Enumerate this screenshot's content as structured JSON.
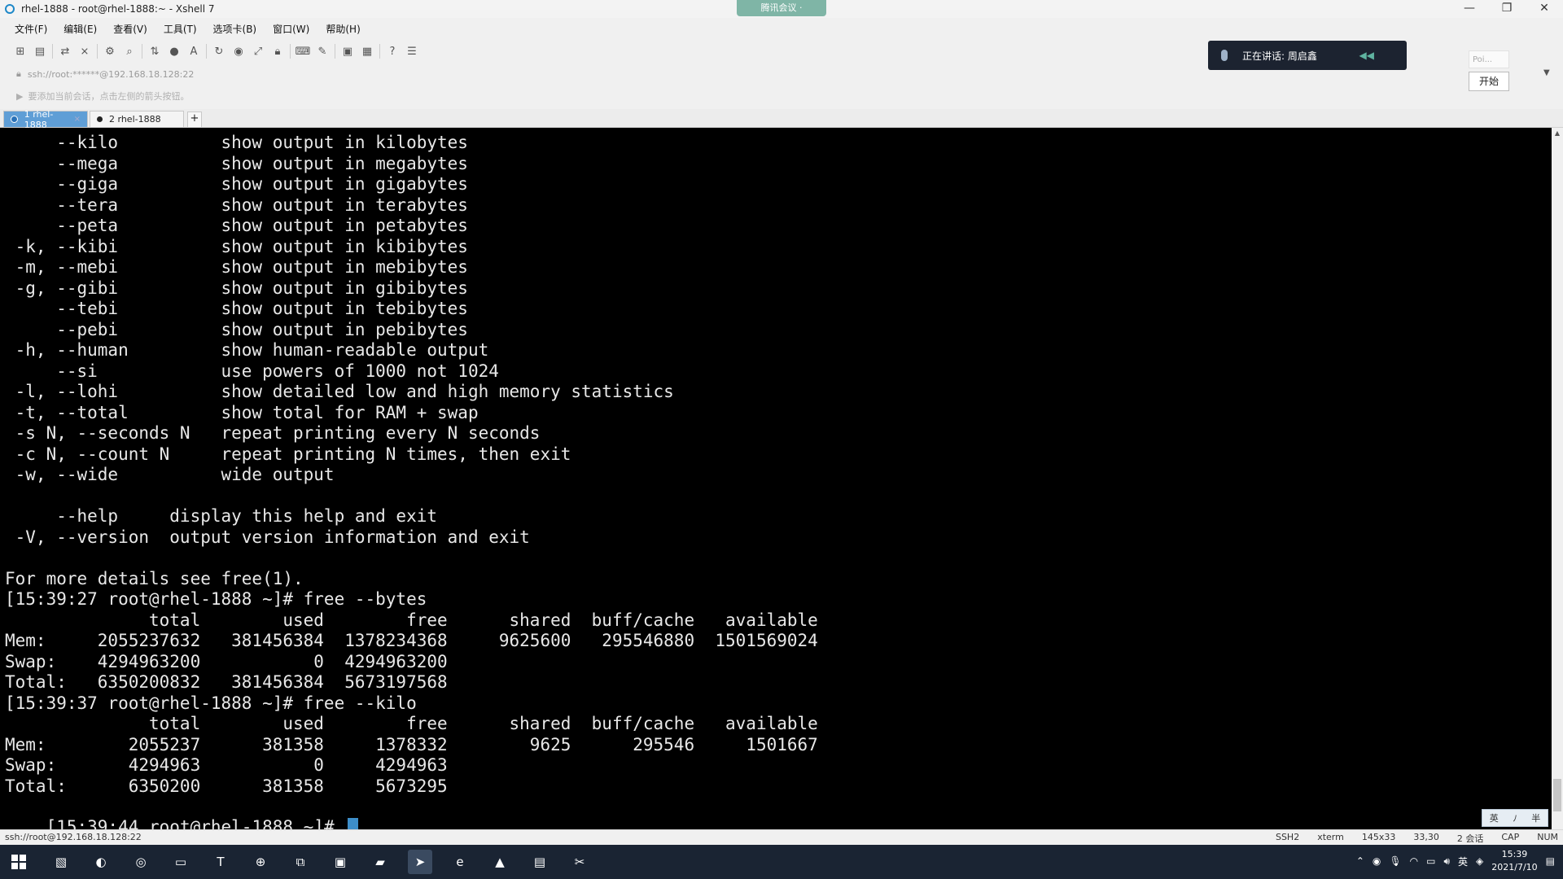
{
  "window": {
    "title": "rhel-1888 - root@rhel-1888:~ - Xshell 7",
    "meeting_tab": "腾讯会议 ·",
    "controls": [
      "—",
      "❐",
      "✕"
    ]
  },
  "menu": [
    "文件(F)",
    "编辑(E)",
    "查看(V)",
    "工具(T)",
    "选项卡(B)",
    "窗口(W)",
    "帮助(H)"
  ],
  "toolbar_icons": [
    "new-session-icon",
    "open-folder-icon",
    "reconnect-icon",
    "disconnect-icon",
    "properties-icon",
    "find-icon",
    "transfer-icon",
    "globe-icon",
    "font-icon",
    "refresh-icon",
    "xftp-icon",
    "fullscreen-icon",
    "lock-icon",
    "keyboard-icon",
    "script-icon",
    "layout-icon",
    "tile-icon",
    "help-icon",
    "chat-icon"
  ],
  "address": "ssh://root:******@192.168.18.128:22",
  "hint": "要添加当前会话，点击左侧的箭头按钮。",
  "meeting": {
    "speaking": "正在讲话: 周启鑫",
    "side_placeholder": "Poi...",
    "start": "开始"
  },
  "tabs": [
    {
      "label": "1 rhel-1888",
      "active": true
    },
    {
      "label": "2 rhel-1888",
      "active": false
    }
  ],
  "terminal_lines": [
    "     --kilo          show output in kilobytes",
    "     --mega          show output in megabytes",
    "     --giga          show output in gigabytes",
    "     --tera          show output in terabytes",
    "     --peta          show output in petabytes",
    " -k, --kibi          show output in kibibytes",
    " -m, --mebi          show output in mebibytes",
    " -g, --gibi          show output in gibibytes",
    "     --tebi          show output in tebibytes",
    "     --pebi          show output in pebibytes",
    " -h, --human         show human-readable output",
    "     --si            use powers of 1000 not 1024",
    " -l, --lohi          show detailed low and high memory statistics",
    " -t, --total         show total for RAM + swap",
    " -s N, --seconds N   repeat printing every N seconds",
    " -c N, --count N     repeat printing N times, then exit",
    " -w, --wide          wide output",
    "",
    "     --help     display this help and exit",
    " -V, --version  output version information and exit",
    "",
    "For more details see free(1).",
    "[15:39:27 root@rhel-1888 ~]# free --bytes",
    "              total        used        free      shared  buff/cache   available",
    "Mem:     2055237632   381456384  1378234368     9625600   295546880  1501569024",
    "Swap:    4294963200           0  4294963200",
    "Total:   6350200832   381456384  5673197568",
    "[15:39:37 root@rhel-1888 ~]# free --kilo",
    "              total        used        free      shared  buff/cache   available",
    "Mem:        2055237      381358     1378332        9625      295546     1501667",
    "Swap:       4294963           0     4294963",
    "Total:      6350200      381358     5673295"
  ],
  "prompt": "[15:39:44 root@rhel-1888 ~]# ",
  "ime": [
    "英",
    "ﾉ",
    "半"
  ],
  "status": {
    "left": "ssh://root@192.168.18.128:22",
    "protocol": "SSH2",
    "term": "xterm",
    "size": "145x33",
    "pos": "33,30",
    "sessions": "2 会话",
    "caps": "CAP",
    "num": "NUM"
  },
  "taskbar": {
    "apps": [
      "file-icon",
      "browser-icon",
      "chrome-icon",
      "folder-icon",
      "typora-icon",
      "network-icon",
      "vm-icon",
      "terminal-icon",
      "notes-icon",
      "xshell-icon",
      "ie-icon",
      "photos-icon",
      "chat-app-icon",
      "snip-icon"
    ],
    "active_index": 9,
    "lang": "英",
    "time": "15:39",
    "date": "2021/7/10"
  },
  "colors": {
    "terminal_bg": "#000000",
    "terminal_fg": "#e8e8e8",
    "cursor": "#3d8ec9",
    "tab_active": "#5f9ed6",
    "taskbar": "#1a2433"
  }
}
